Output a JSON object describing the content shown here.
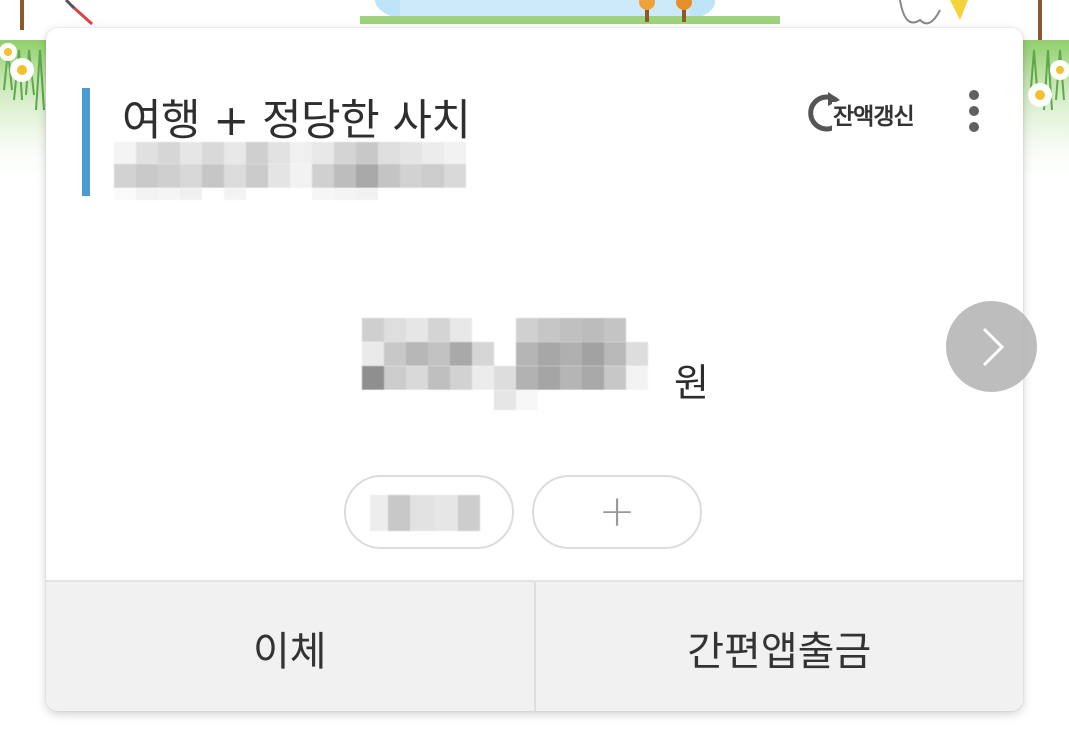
{
  "card": {
    "title": "여행 + 정당한 사치",
    "account_number_masked": true,
    "accent_color": "#4b9ad4"
  },
  "refresh": {
    "label": "잔액갱신",
    "icon": "refresh-icon"
  },
  "more": {
    "icon": "more-vertical-icon"
  },
  "balance": {
    "amount_masked": true,
    "currency": "원"
  },
  "chips": {
    "label_masked": true,
    "add_label": "+"
  },
  "actions": {
    "transfer_label": "이체",
    "easy_app_withdraw_label": "간편앱출금"
  },
  "navigation": {
    "next_icon": "chevron-right-icon"
  }
}
